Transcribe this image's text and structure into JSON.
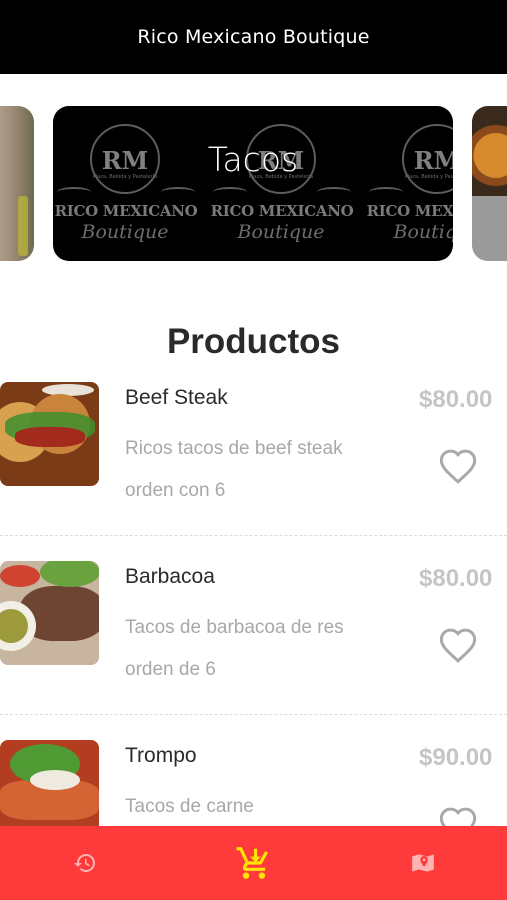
{
  "header": {
    "title": "Rico Mexicano Boutique"
  },
  "carousel": {
    "active_title": "Tacos",
    "logo": {
      "monogram": "RM",
      "tagline": "Plaza, Bebida y Pastelería",
      "word": "RICO MEXICANO",
      "script": "Boutique"
    }
  },
  "section": {
    "title": "Productos"
  },
  "products": [
    {
      "name": "Beef Steak",
      "description": "Ricos tacos de beef steak orden con 6",
      "price": "$80.00"
    },
    {
      "name": "Barbacoa",
      "description": "Tacos de barbacoa de res orden de 6",
      "price": "$80.00"
    },
    {
      "name": "Trompo",
      "description": "Tacos de carne",
      "price": "$90.00"
    }
  ],
  "bottom_nav": {
    "items": [
      {
        "icon": "history-icon"
      },
      {
        "icon": "cart-download-icon",
        "active": true
      },
      {
        "icon": "map-location-icon"
      }
    ]
  },
  "colors": {
    "header_bg": "#000000",
    "nav_bg": "#ff3a3a",
    "nav_icon": "#ffb3b3",
    "nav_active_icon": "#ffe600",
    "price": "#c5c5c5",
    "heart": "#a9a9a9"
  }
}
